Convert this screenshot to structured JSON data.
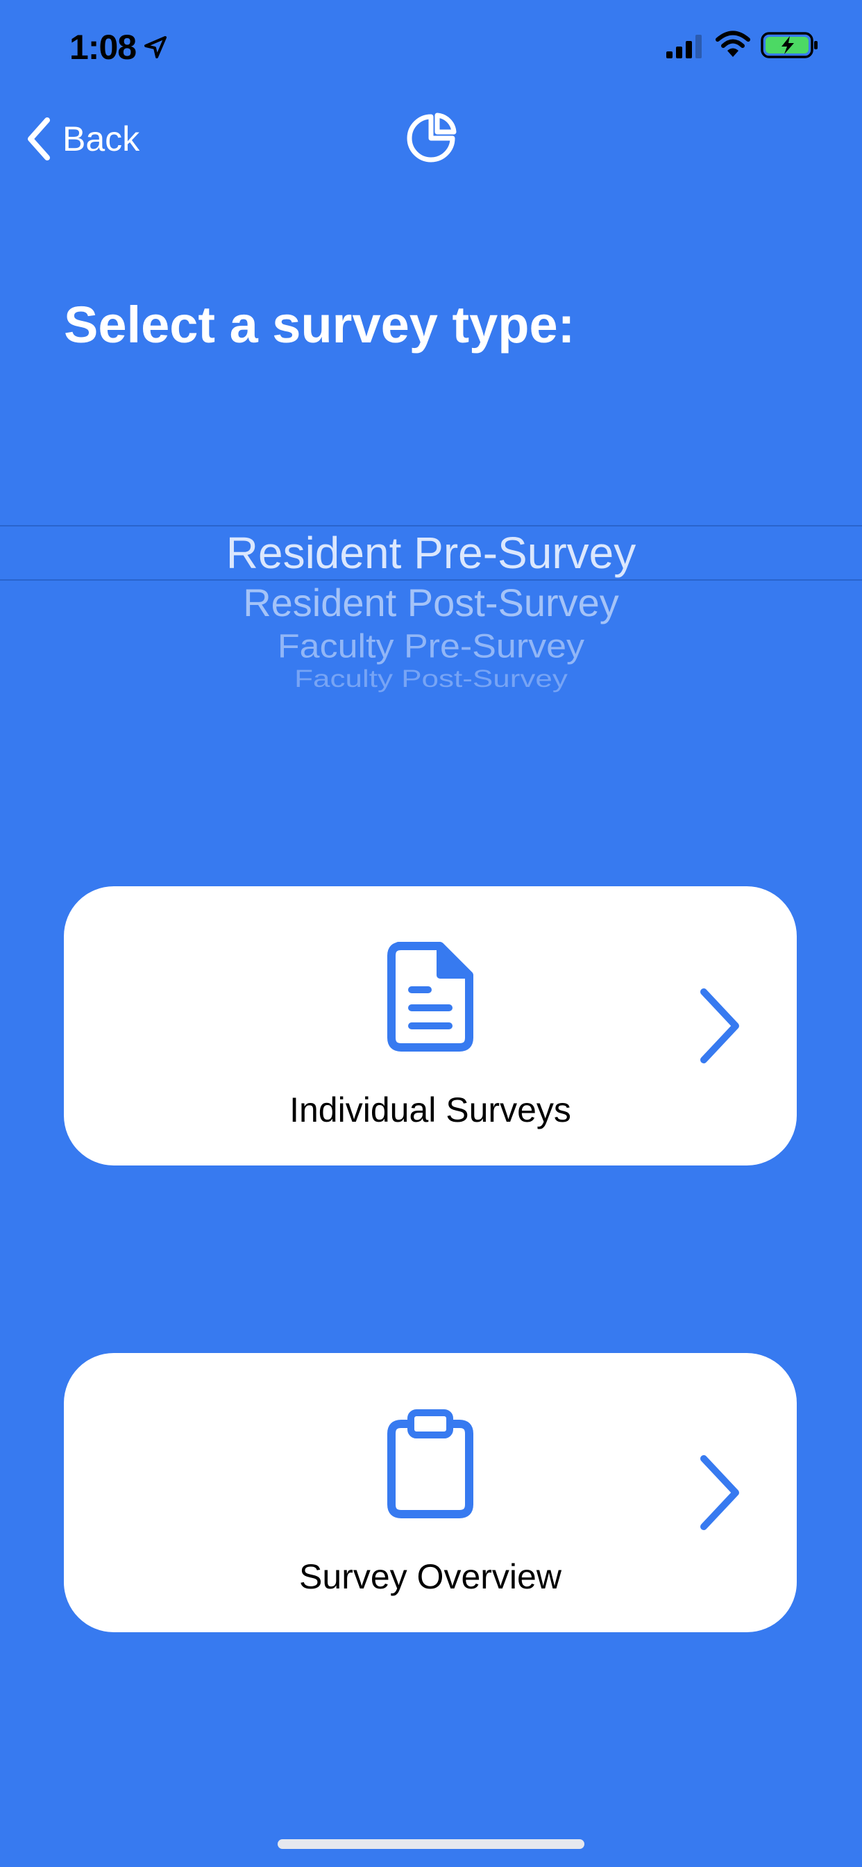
{
  "colors": {
    "background": "#377AF0",
    "card": "#FFFFFF",
    "accent": "#377AF0",
    "battery_fill": "#4CD964",
    "status_text": "#000000"
  },
  "status_bar": {
    "time": "1:08",
    "icons": [
      "location-arrow-icon",
      "cellular-signal-icon",
      "wifi-icon",
      "battery-charging-icon"
    ]
  },
  "nav": {
    "back_label": "Back",
    "back_icon": "chevron-left-icon",
    "right_icon": "pie-chart-icon"
  },
  "page": {
    "title": "Select a survey type:"
  },
  "picker": {
    "selected_index": 0,
    "options": [
      "Resident Pre-Survey",
      "Resident Post-Survey",
      "Faculty Pre-Survey",
      "Faculty Post-Survey"
    ]
  },
  "cards": [
    {
      "label": "Individual Surveys",
      "icon": "document-icon",
      "chevron_icon": "chevron-right-icon"
    },
    {
      "label": "Survey Overview",
      "icon": "clipboard-icon",
      "chevron_icon": "chevron-right-icon"
    }
  ]
}
